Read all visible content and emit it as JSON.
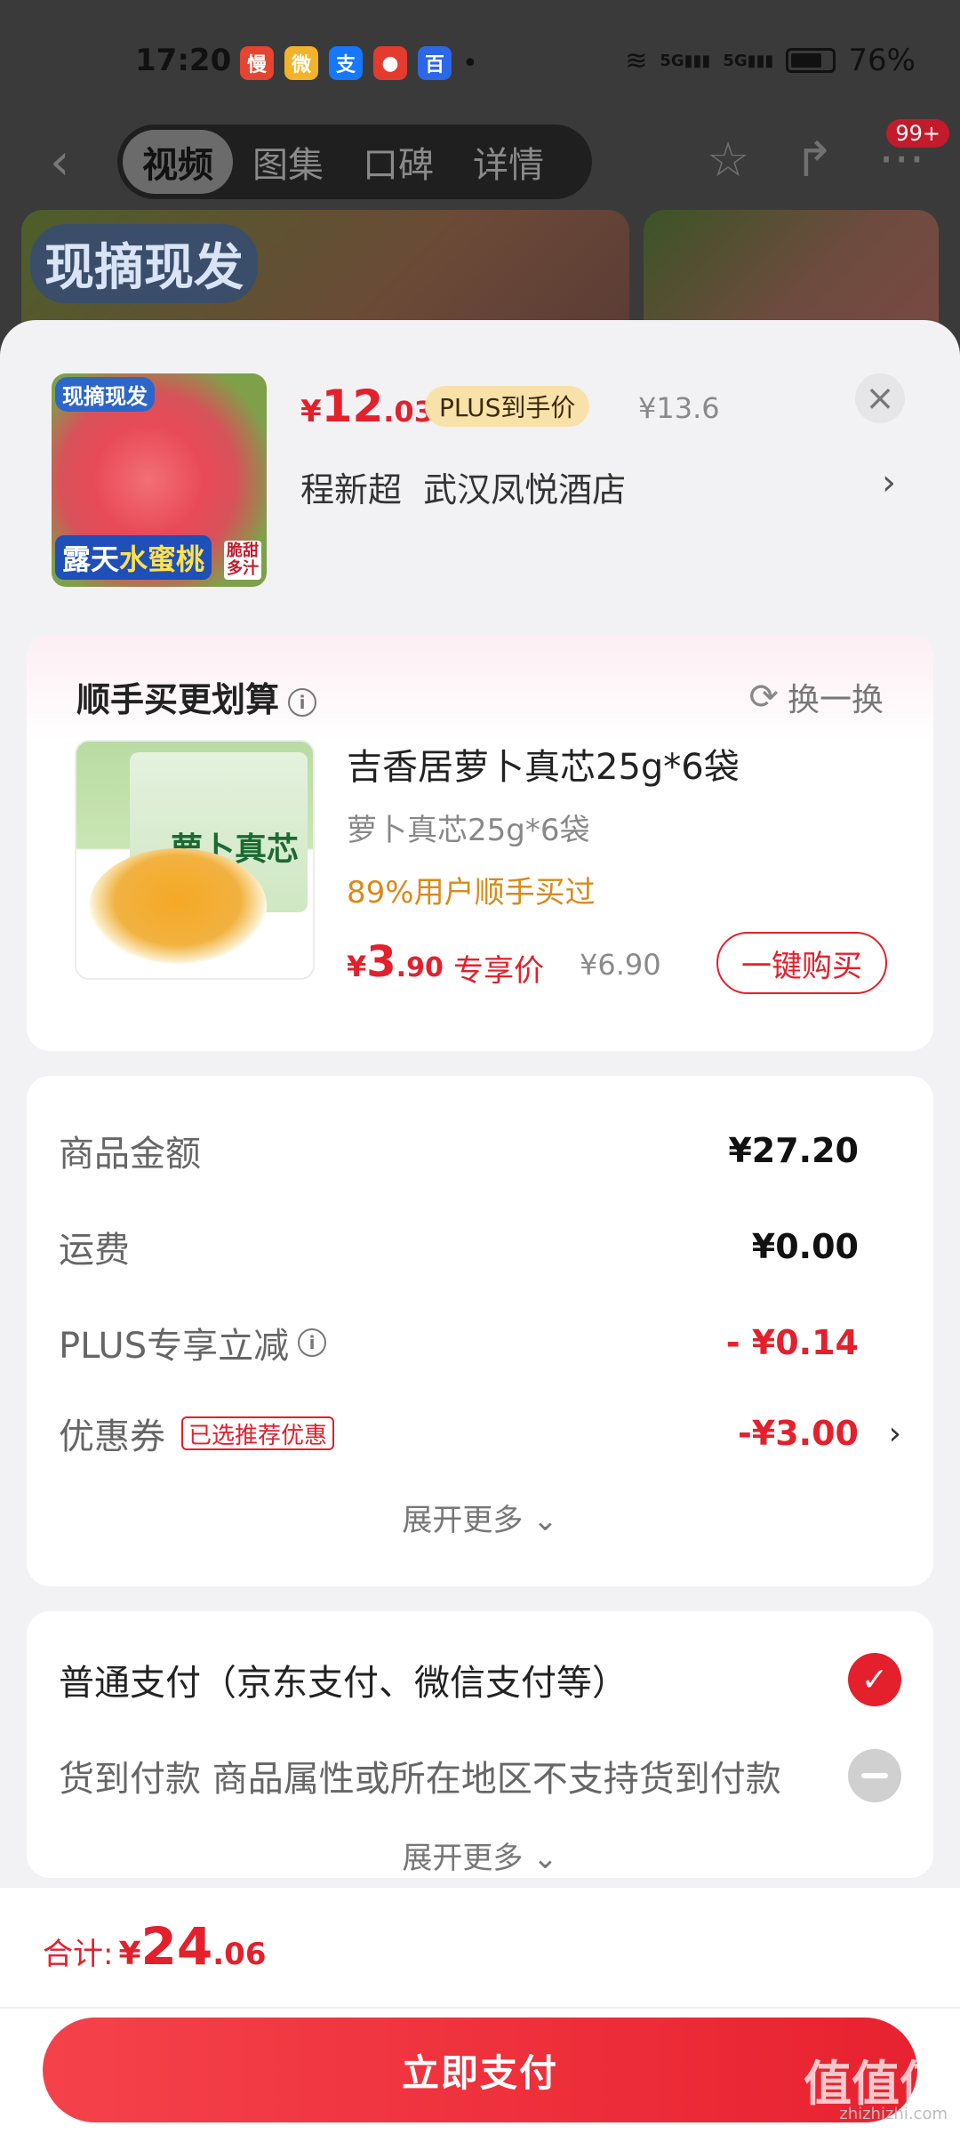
{
  "status_bar": {
    "time": "17:20",
    "apps": [
      {
        "name": "app-icon-1",
        "glyph": "慢",
        "color": "#e54430"
      },
      {
        "name": "weibo-icon",
        "glyph": "微",
        "color": "#f2b32a"
      },
      {
        "name": "alipay-icon",
        "glyph": "支",
        "color": "#1677ff"
      },
      {
        "name": "app-icon-4",
        "glyph": "●",
        "color": "#e43b2e"
      },
      {
        "name": "baidu-icon",
        "glyph": "百",
        "color": "#2b67e8"
      }
    ],
    "dot": "•",
    "network1": "5G",
    "network2": "5G",
    "battery": "76%"
  },
  "nav": {
    "tabs": [
      "视频",
      "图集",
      "口碑",
      "详情"
    ],
    "active_tab": 0,
    "badge": "99+"
  },
  "background": {
    "stamp_text": "现摘现发"
  },
  "product": {
    "thumb_tag_top": "现摘现发",
    "thumb_tag_bottom_a": "露天",
    "thumb_tag_bottom_b": "水蜜桃",
    "thumb_tag_side": "脆甜多汁",
    "price_yen": "¥",
    "price_int": "12",
    "price_dec": ".03",
    "plus_tag": "PLUS到手价",
    "orig_price": "¥13.6",
    "close_glyph": "×",
    "address": "程新超  武汉凤悦酒店",
    "address_arrow": "›"
  },
  "addon": {
    "title": "顺手买更划算",
    "info_glyph": "i",
    "swap_label": "换一换",
    "swap_glyph": "⟳",
    "thumb_brand": "萝卜真芯",
    "name": "吉香居萝卜真芯25g*6袋",
    "spec": "萝卜真芯25g*6袋",
    "stat": "89%用户顺手买过",
    "price_yen": "¥",
    "price_int": "3",
    "price_dec": ".90",
    "exclusive": "专享价",
    "orig_price": "¥6.90",
    "buy_label": "一键购买"
  },
  "summary": {
    "rows": [
      {
        "label": "商品金额",
        "value": "¥27.20"
      },
      {
        "label": "运费",
        "value": "¥0.00"
      },
      {
        "label": "PLUS专享立减",
        "value": "- ¥0.14"
      },
      {
        "label": "优惠券",
        "tag": "已选推荐优惠",
        "value": "-¥3.00"
      }
    ],
    "arrow": "›",
    "expand": "展开更多 ⌄"
  },
  "payment": {
    "option1": "普通支付（京东支付、微信支付等）",
    "option2": "货到付款  商品属性或所在地区不支持货到付款",
    "check_glyph": "✓",
    "expand": "展开更多 ⌄"
  },
  "bottom": {
    "total_label": "合计:",
    "total_yen": "¥",
    "total_int": "24",
    "total_dec": ".06",
    "pay_button": "立即支付",
    "watermark": "值值值",
    "watermark_sub": "zhizhizhi.com"
  },
  "colors": {
    "accent": "#e3202c",
    "plus_tag_bg": "#f9e2aa",
    "stat_orange": "#d98a18"
  }
}
